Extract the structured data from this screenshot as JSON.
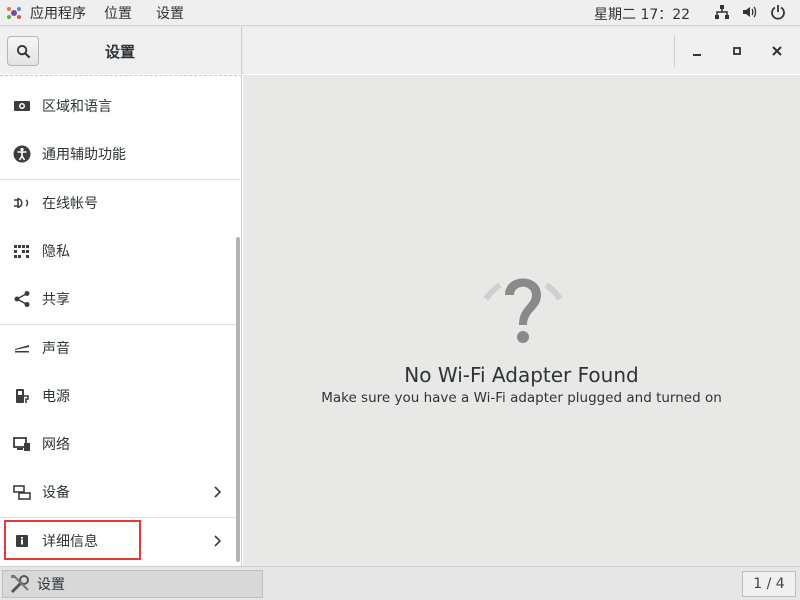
{
  "topbar": {
    "applications": "应用程序",
    "places": "位置",
    "settings": "设置",
    "clock": "星期二 17：22"
  },
  "window": {
    "title": "设置",
    "buttons": [
      "minimize",
      "maximize",
      "close"
    ]
  },
  "sidebar": {
    "items": [
      {
        "label": "区域和语言",
        "icon": "region-icon"
      },
      {
        "label": "通用辅助功能",
        "icon": "accessibility-icon"
      },
      {
        "label": "在线帐号",
        "icon": "online-accounts-icon"
      },
      {
        "label": "隐私",
        "icon": "privacy-icon"
      },
      {
        "label": "共享",
        "icon": "share-icon"
      },
      {
        "label": "声音",
        "icon": "sound-icon"
      },
      {
        "label": "电源",
        "icon": "power-icon"
      },
      {
        "label": "网络",
        "icon": "network-icon"
      },
      {
        "label": "设备",
        "icon": "devices-icon",
        "has_submenu": true,
        "highlighted": true
      },
      {
        "label": "详细信息",
        "icon": "info-icon",
        "has_submenu": true
      }
    ]
  },
  "main": {
    "title": "No Wi-Fi Adapter Found",
    "subtitle": "Make sure you have a Wi-Fi adapter plugged and turned on"
  },
  "taskbar": {
    "task_label": "设置",
    "pager": "1 / 4"
  },
  "colors": {
    "highlight_border": "#e53935",
    "empty_icon": "#8a8a8a"
  }
}
